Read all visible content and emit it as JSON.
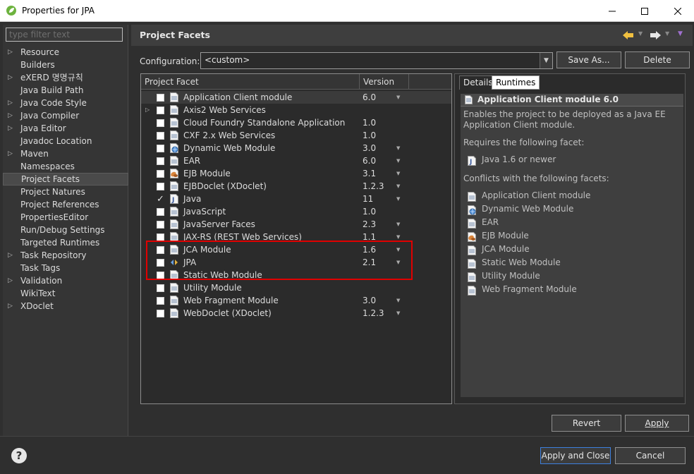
{
  "window": {
    "title": "Properties for JPA"
  },
  "filter": {
    "placeholder": "type filter text"
  },
  "sidebar": {
    "items": [
      {
        "label": "Resource",
        "expandable": true
      },
      {
        "label": "Builders",
        "expandable": false
      },
      {
        "label": "eXERD 명명규칙",
        "expandable": true
      },
      {
        "label": "Java Build Path",
        "expandable": false
      },
      {
        "label": "Java Code Style",
        "expandable": true
      },
      {
        "label": "Java Compiler",
        "expandable": true
      },
      {
        "label": "Java Editor",
        "expandable": true
      },
      {
        "label": "Javadoc Location",
        "expandable": false
      },
      {
        "label": "Maven",
        "expandable": true
      },
      {
        "label": "Namespaces",
        "expandable": false
      },
      {
        "label": "Project Facets",
        "expandable": false,
        "selected": true
      },
      {
        "label": "Project Natures",
        "expandable": false
      },
      {
        "label": "Project References",
        "expandable": false
      },
      {
        "label": "PropertiesEditor",
        "expandable": false
      },
      {
        "label": "Run/Debug Settings",
        "expandable": false
      },
      {
        "label": "Targeted Runtimes",
        "expandable": false
      },
      {
        "label": "Task Repository",
        "expandable": true
      },
      {
        "label": "Task Tags",
        "expandable": false
      },
      {
        "label": "Validation",
        "expandable": true
      },
      {
        "label": "WikiText",
        "expandable": false
      },
      {
        "label": "XDoclet",
        "expandable": true
      }
    ]
  },
  "page": {
    "title": "Project Facets",
    "configuration_label": "Configuration:",
    "configuration_value": "<custom>",
    "save_as_label": "Save As...",
    "delete_label": "Delete"
  },
  "facets_table": {
    "headers": [
      "Project Facet",
      "Version"
    ],
    "rows": [
      {
        "name": "Application Client module",
        "version": "6.0",
        "checked": false,
        "has_versions": true,
        "icon": "page-icon",
        "selected": true
      },
      {
        "name": "Axis2 Web Services",
        "version": "",
        "checked": false,
        "has_versions": false,
        "icon": "page-icon",
        "expandable": true
      },
      {
        "name": "Cloud Foundry Standalone Application",
        "version": "1.0",
        "checked": false,
        "has_versions": false,
        "icon": "page-icon"
      },
      {
        "name": "CXF 2.x Web Services",
        "version": "1.0",
        "checked": false,
        "has_versions": false,
        "icon": "page-icon"
      },
      {
        "name": "Dynamic Web Module",
        "version": "3.0",
        "checked": false,
        "has_versions": true,
        "icon": "globe-page-icon"
      },
      {
        "name": "EAR",
        "version": "6.0",
        "checked": false,
        "has_versions": true,
        "icon": "page-icon"
      },
      {
        "name": "EJB Module",
        "version": "3.1",
        "checked": false,
        "has_versions": true,
        "icon": "bean-icon"
      },
      {
        "name": "EJBDoclet (XDoclet)",
        "version": "1.2.3",
        "checked": false,
        "has_versions": true,
        "icon": "page-icon"
      },
      {
        "name": "Java",
        "version": "11",
        "checked": true,
        "has_versions": true,
        "icon": "java-icon"
      },
      {
        "name": "JavaScript",
        "version": "1.0",
        "checked": false,
        "has_versions": false,
        "icon": "page-icon"
      },
      {
        "name": "JavaServer Faces",
        "version": "2.3",
        "checked": false,
        "has_versions": true,
        "icon": "page-icon"
      },
      {
        "name": "JAX-RS (REST Web Services)",
        "version": "1.1",
        "checked": false,
        "has_versions": true,
        "icon": "page-icon"
      },
      {
        "name": "JCA Module",
        "version": "1.6",
        "checked": false,
        "has_versions": true,
        "icon": "page-icon"
      },
      {
        "name": "JPA",
        "version": "2.1",
        "checked": false,
        "has_versions": true,
        "icon": "jpa-icon"
      },
      {
        "name": "Static Web Module",
        "version": "",
        "checked": false,
        "has_versions": false,
        "icon": "page-icon"
      },
      {
        "name": "Utility Module",
        "version": "",
        "checked": false,
        "has_versions": false,
        "icon": "page-icon"
      },
      {
        "name": "Web Fragment Module",
        "version": "3.0",
        "checked": false,
        "has_versions": true,
        "icon": "page-icon"
      },
      {
        "name": "WebDoclet (XDoclet)",
        "version": "1.2.3",
        "checked": false,
        "has_versions": true,
        "icon": "page-icon"
      }
    ]
  },
  "details": {
    "tabs": [
      "Details",
      "Runtimes"
    ],
    "title": "Application Client module 6.0",
    "description_line1": "Enables the project to be deployed as a Java EE",
    "description_line2": "Application Client module.",
    "requires_label": "Requires the following facet:",
    "requires": [
      {
        "label": "Java 1.6 or newer",
        "icon": "java-icon"
      }
    ],
    "conflicts_label": "Conflicts with the following facets:",
    "conflicts": [
      {
        "label": "Application Client module",
        "icon": "page-icon"
      },
      {
        "label": "Dynamic Web Module",
        "icon": "globe-page-icon"
      },
      {
        "label": "EAR",
        "icon": "page-icon"
      },
      {
        "label": "EJB Module",
        "icon": "bean-icon"
      },
      {
        "label": "JCA Module",
        "icon": "page-icon"
      },
      {
        "label": "Static Web Module",
        "icon": "page-icon"
      },
      {
        "label": "Utility Module",
        "icon": "page-icon"
      },
      {
        "label": "Web Fragment Module",
        "icon": "page-icon"
      }
    ]
  },
  "buttons": {
    "revert": "Revert",
    "apply": "Apply",
    "apply_close": "Apply and Close",
    "cancel": "Cancel"
  },
  "colors": {
    "highlight": "#e00000",
    "primary_border": "#3d80df",
    "nav_arrow": "#f0c040"
  }
}
